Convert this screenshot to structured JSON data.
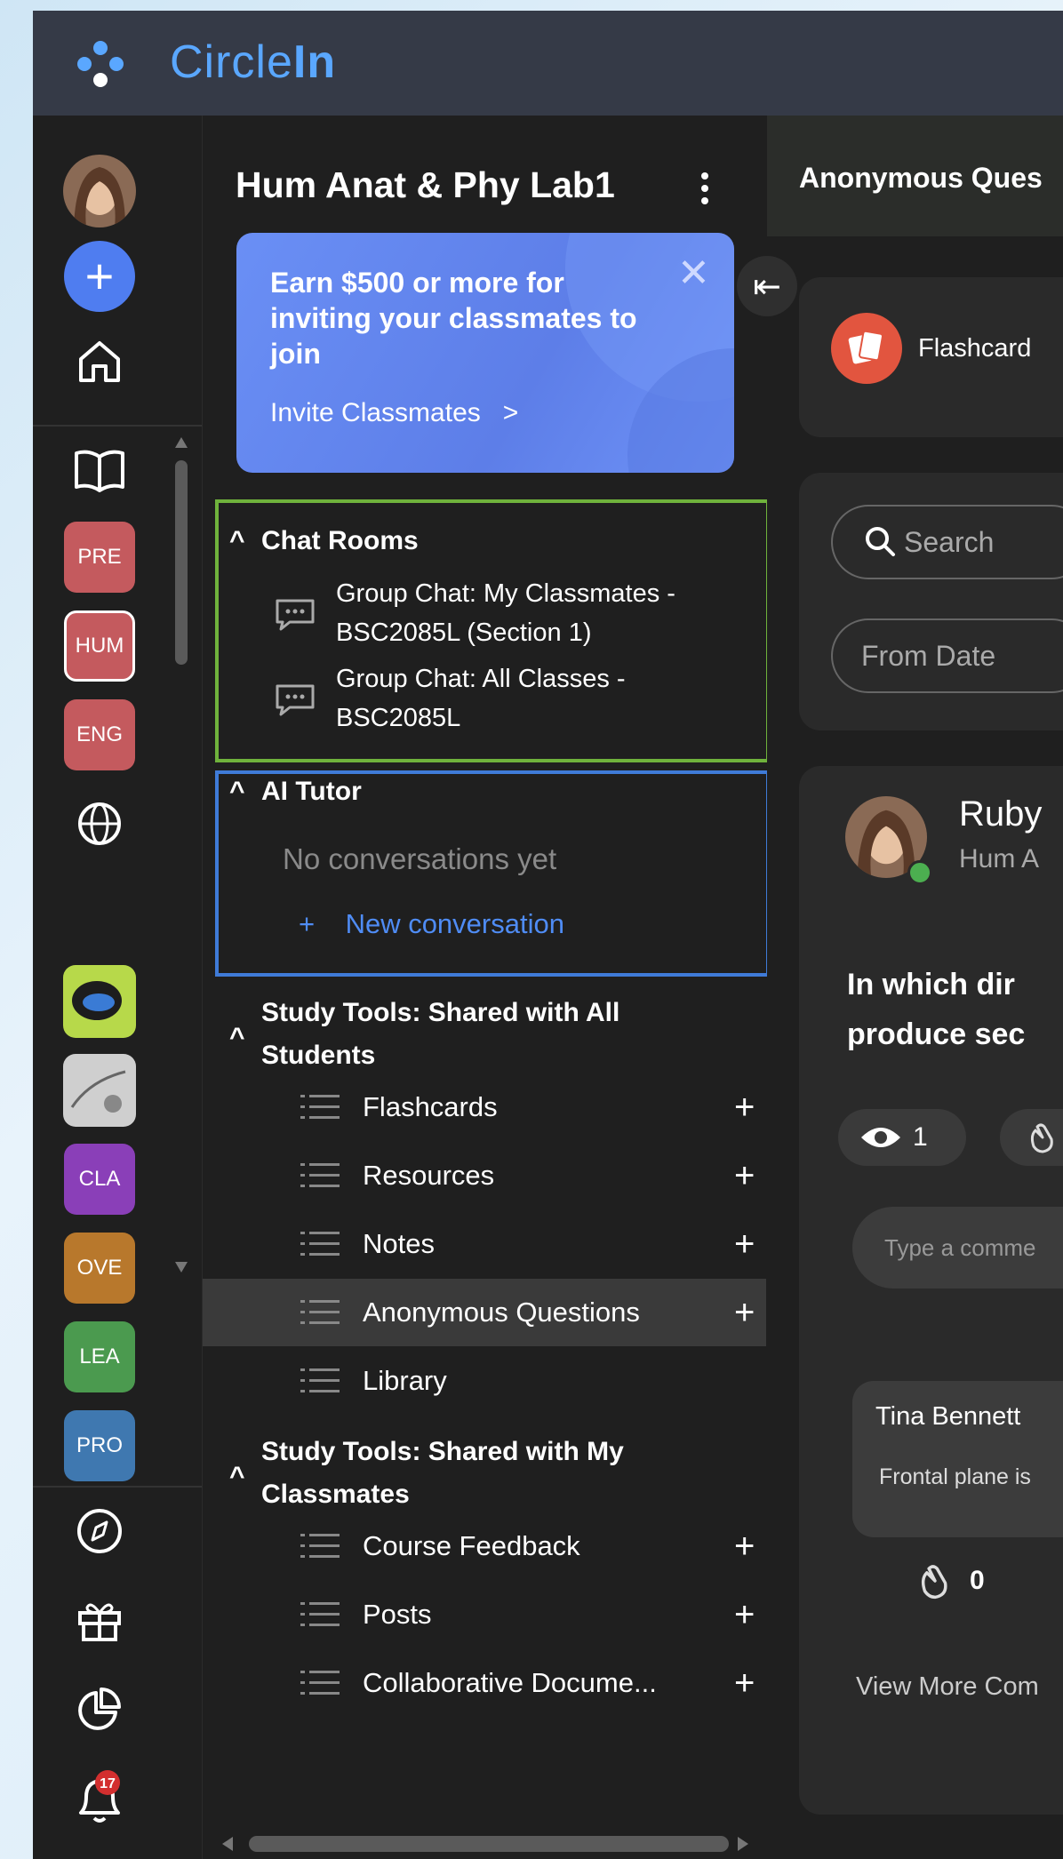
{
  "app": {
    "name_light": "Circle",
    "name_bold": "In",
    "brand_color": "#5aa7ff"
  },
  "rail": {
    "class_tiles": [
      {
        "label": "PRE",
        "color": "#c45a5e",
        "selected": false
      },
      {
        "label": "HUM",
        "color": "#c45a5e",
        "selected": true
      },
      {
        "label": "ENG",
        "color": "#c45a5e",
        "selected": false
      },
      {
        "label": "CLA",
        "color": "#8a3fb8",
        "selected": false
      },
      {
        "label": "OVE",
        "color": "#b8782c",
        "selected": false
      },
      {
        "label": "LEA",
        "color": "#4b9a4f",
        "selected": false
      },
      {
        "label": "PRO",
        "color": "#3f78b0",
        "selected": false
      }
    ],
    "notification_count": "17"
  },
  "sidebar": {
    "title": "Hum Anat & Phy Lab1",
    "promo": {
      "headline": "Earn $500 or more for inviting your classmates to join",
      "link": "Invite Classmates",
      "link_arrow": ">"
    },
    "chat_rooms": {
      "heading": "Chat Rooms",
      "items": [
        {
          "line1": "Group Chat: My Classmates -",
          "line2": "BSC2085L (Section 1)"
        },
        {
          "line1": "Group Chat: All Classes -",
          "line2": "BSC2085L"
        }
      ]
    },
    "ai_tutor": {
      "heading": "AI Tutor",
      "empty": "No conversations yet",
      "new_label": "New conversation"
    },
    "shared_all": {
      "heading_line1": "Study Tools: Shared with All",
      "heading_line2": "Students",
      "items": [
        "Flashcards",
        "Resources",
        "Notes",
        "Anonymous Questions",
        "Library"
      ]
    },
    "shared_classmates": {
      "heading_line1": "Study Tools: Shared with My",
      "heading_line2": "Classmates",
      "items": [
        "Course Feedback",
        "Posts",
        "Collaborative Docume..."
      ]
    }
  },
  "main": {
    "tab_label": "Anonymous Ques",
    "flashcard_label": "Flashcard",
    "search_placeholder": "Search",
    "from_date": "From Date",
    "post": {
      "author": "Ruby",
      "class": "Hum A",
      "question_line1": "In which dir",
      "question_line2": "produce sec",
      "views": "1",
      "comment_placeholder": "Type a comme",
      "reply_author": "Tina Bennett",
      "reply_text": "Frontal plane is",
      "clap_count": "0",
      "view_more": "View More Com"
    }
  }
}
